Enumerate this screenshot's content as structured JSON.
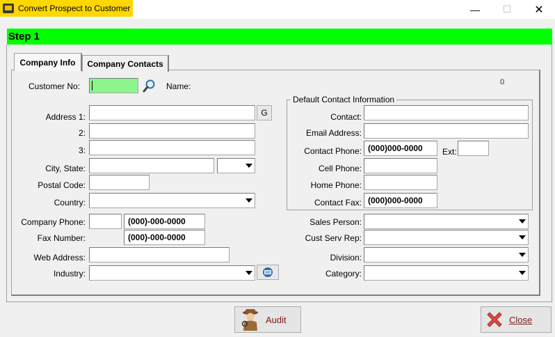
{
  "window": {
    "title": "Convert Prospect to Customer",
    "min_glyph": "—",
    "max_glyph": "☐",
    "close_glyph": "✕"
  },
  "step": {
    "title": "Step 1"
  },
  "tabs": [
    {
      "label": "Company Info",
      "active": true
    },
    {
      "label": "Company Contacts",
      "active": false
    }
  ],
  "form": {
    "customer_no_label": "Customer No:",
    "customer_no_value": "",
    "name_label": "Name:",
    "counter": "0",
    "address1_label": "Address 1:",
    "address2_label": "2:",
    "address3_label": "3:",
    "geocode_button": "G",
    "city_state_label": "City, State:",
    "postal_code_label": "Postal Code:",
    "country_label": "Country:",
    "company_phone_label": "Company Phone:",
    "company_phone_value": "(000)-000-0000",
    "fax_label": "Fax Number:",
    "fax_value": "(000)-000-0000",
    "web_label": "Web Address:",
    "industry_label": "Industry:"
  },
  "contact": {
    "group_title": "Default Contact Information",
    "contact_label": "Contact:",
    "email_label": "Email Address:",
    "contact_phone_label": "Contact Phone:",
    "contact_phone_value": "(000)000-0000",
    "ext_label": "Ext:",
    "cell_label": "Cell Phone:",
    "home_label": "Home Phone:",
    "fax_label": "Contact Fax:",
    "fax_value": "(000)000-0000"
  },
  "assignments": {
    "sales_person_label": "Sales Person:",
    "cust_serv_label": "Cust Serv Rep:",
    "division_label": "Division:",
    "category_label": "Category:"
  },
  "buttons": {
    "audit": "Audit",
    "close": "Close"
  },
  "colors": {
    "title_highlight": "#ffd700",
    "step_bar": "#00ff00",
    "customer_no_field": "#8cf58c"
  },
  "icons": {
    "app": "app-icon",
    "search": "magnifier-icon",
    "lookup": "lookup-icon",
    "audit": "detective-icon",
    "close": "red-x-icon"
  }
}
